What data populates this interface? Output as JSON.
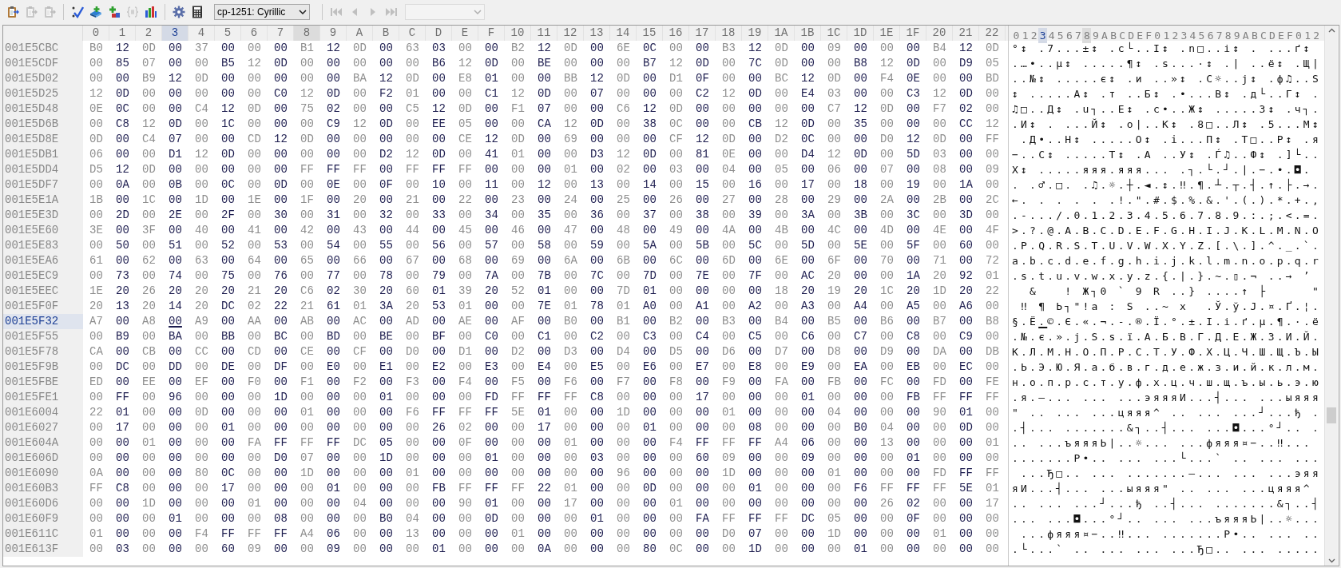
{
  "toolbar": [
    {
      "kind": "clipboard",
      "disabled": false
    },
    {
      "kind": "clipboard",
      "disabled": true
    },
    {
      "kind": "clipboard",
      "disabled": true
    },
    {
      "kind": "separator"
    },
    {
      "kind": "check",
      "disabled": false
    },
    {
      "kind": "book-plus",
      "disabled": false
    },
    {
      "kind": "blocks-plus",
      "disabled": false
    },
    {
      "kind": "brackets",
      "disabled": true
    },
    {
      "kind": "bar-chart",
      "disabled": false
    },
    {
      "kind": "separator"
    },
    {
      "kind": "gear",
      "disabled": false
    },
    {
      "kind": "calculator",
      "disabled": false
    },
    {
      "kind": "dropdown",
      "value": "cp-1251: Cyrillic",
      "disabled": false
    },
    {
      "kind": "separator"
    },
    {
      "kind": "first",
      "disabled": true
    },
    {
      "kind": "prev",
      "disabled": true
    },
    {
      "kind": "next",
      "disabled": true
    },
    {
      "kind": "last",
      "disabled": true
    },
    {
      "kind": "dropdown",
      "disabled": true
    }
  ],
  "columns": [
    {
      "label": "0",
      "selected": false,
      "marked": false
    },
    {
      "label": "1",
      "selected": false,
      "marked": false
    },
    {
      "label": "2",
      "selected": false,
      "marked": false
    },
    {
      "label": "3",
      "selected": true,
      "marked": false
    },
    {
      "label": "4",
      "selected": false,
      "marked": false
    },
    {
      "label": "5",
      "selected": false,
      "marked": false
    },
    {
      "label": "6",
      "selected": false,
      "marked": false
    },
    {
      "label": "7",
      "selected": false,
      "marked": false
    },
    {
      "label": "8",
      "selected": false,
      "marked": true
    },
    {
      "label": "9",
      "selected": false,
      "marked": false
    },
    {
      "label": "A",
      "selected": false,
      "marked": false
    },
    {
      "label": "B",
      "selected": false,
      "marked": false
    },
    {
      "label": "C",
      "selected": false,
      "marked": false
    },
    {
      "label": "D",
      "selected": false,
      "marked": false
    },
    {
      "label": "E",
      "selected": false,
      "marked": false
    },
    {
      "label": "F",
      "selected": false,
      "marked": false
    },
    {
      "label": "10",
      "selected": false,
      "marked": false
    },
    {
      "label": "11",
      "selected": false,
      "marked": false
    },
    {
      "label": "12",
      "selected": false,
      "marked": false
    },
    {
      "label": "13",
      "selected": false,
      "marked": false
    },
    {
      "label": "14",
      "selected": false,
      "marked": false
    },
    {
      "label": "15",
      "selected": false,
      "marked": false
    },
    {
      "label": "16",
      "selected": false,
      "marked": false
    },
    {
      "label": "17",
      "selected": false,
      "marked": false
    },
    {
      "label": "18",
      "selected": false,
      "marked": false
    },
    {
      "label": "19",
      "selected": false,
      "marked": false
    },
    {
      "label": "1A",
      "selected": false,
      "marked": false
    },
    {
      "label": "1B",
      "selected": false,
      "marked": false
    },
    {
      "label": "1C",
      "selected": false,
      "marked": false
    },
    {
      "label": "1D",
      "selected": false,
      "marked": false
    },
    {
      "label": "1E",
      "selected": false,
      "marked": false
    },
    {
      "label": "1F",
      "selected": false,
      "marked": false
    },
    {
      "label": "20",
      "selected": false,
      "marked": false
    },
    {
      "label": "21",
      "selected": false,
      "marked": false
    },
    {
      "label": "22",
      "selected": false,
      "marked": false
    }
  ],
  "text_header": "0123456789ABCDEF0123456789ABCDEF012",
  "rows": [
    {
      "offset": "001E5CBC",
      "selected": false,
      "bytes": [
        "B0",
        "12",
        "0D",
        "00",
        "37",
        "00",
        "00",
        "00",
        "B1",
        "12",
        "0D",
        "00",
        "63",
        "03",
        "00",
        "00",
        "B2",
        "12",
        "0D",
        "00",
        "6E",
        "0C",
        "00",
        "00",
        "B3",
        "12",
        "0D",
        "00",
        "09",
        "00",
        "00",
        "00",
        "B4",
        "12",
        "0D"
      ],
      "text": "°↕ .7...±↕ .c└..І↕ .n□..і↕ . ...ґ↕ "
    },
    {
      "offset": "001E5CDF",
      "selected": false,
      "bytes": [
        "00",
        "85",
        "07",
        "00",
        "00",
        "B5",
        "12",
        "0D",
        "00",
        "00",
        "00",
        "00",
        "00",
        "B6",
        "12",
        "0D",
        "00",
        "BE",
        "00",
        "00",
        "00",
        "B7",
        "12",
        "0D",
        "00",
        "7C",
        "0D",
        "00",
        "00",
        "B8",
        "12",
        "0D",
        "00",
        "D9",
        "05"
      ],
      "text": ".…•..µ↕ .....¶↕ .ѕ...·↕ .| ..ё↕ .Щ|"
    },
    {
      "offset": "001E5D02",
      "selected": false,
      "bytes": [
        "00",
        "00",
        "B9",
        "12",
        "0D",
        "00",
        "00",
        "00",
        "00",
        "00",
        "BA",
        "12",
        "0D",
        "00",
        "E8",
        "01",
        "00",
        "00",
        "BB",
        "12",
        "0D",
        "00",
        "D1",
        "0F",
        "00",
        "00",
        "BC",
        "12",
        "0D",
        "00",
        "F4",
        "0E",
        "00",
        "00",
        "BD"
      ],
      "text": "..№↕ .....є↕ .и ..»↕ .С☼..ј↕ .ф♫..Ѕ"
    },
    {
      "offset": "001E5D25",
      "selected": false,
      "bytes": [
        "12",
        "0D",
        "00",
        "00",
        "00",
        "00",
        "00",
        "C0",
        "12",
        "0D",
        "00",
        "F2",
        "01",
        "00",
        "00",
        "C1",
        "12",
        "0D",
        "00",
        "07",
        "00",
        "00",
        "00",
        "C2",
        "12",
        "0D",
        "00",
        "E4",
        "03",
        "00",
        "00",
        "C3",
        "12",
        "0D",
        "00"
      ],
      "text": "↕ .....А↕ .т ..Б↕ .•...В↕ .д└..Г↕ ."
    },
    {
      "offset": "001E5D48",
      "selected": false,
      "bytes": [
        "0E",
        "0C",
        "00",
        "00",
        "C4",
        "12",
        "0D",
        "00",
        "75",
        "02",
        "00",
        "00",
        "C5",
        "12",
        "0D",
        "00",
        "F1",
        "07",
        "00",
        "00",
        "C6",
        "12",
        "0D",
        "00",
        "00",
        "00",
        "00",
        "00",
        "C7",
        "12",
        "0D",
        "00",
        "F7",
        "02",
        "00"
      ],
      "text": "♫□..Д↕ .u┐..Е↕ .с•..Ж↕ .....З↕ .ч┐."
    },
    {
      "offset": "001E5D6B",
      "selected": false,
      "bytes": [
        "00",
        "C8",
        "12",
        "0D",
        "00",
        "1C",
        "00",
        "00",
        "00",
        "C9",
        "12",
        "0D",
        "00",
        "EE",
        "05",
        "00",
        "00",
        "CA",
        "12",
        "0D",
        "00",
        "38",
        "0C",
        "00",
        "00",
        "CB",
        "12",
        "0D",
        "00",
        "35",
        "00",
        "00",
        "00",
        "CC",
        "12"
      ],
      "text": ".И↕ . ...Й↕ .о|..К↕ .8□..Л↕ .5...М↕"
    },
    {
      "offset": "001E5D8E",
      "selected": false,
      "bytes": [
        "0D",
        "00",
        "C4",
        "07",
        "00",
        "00",
        "CD",
        "12",
        "0D",
        "00",
        "00",
        "00",
        "00",
        "00",
        "CE",
        "12",
        "0D",
        "00",
        "69",
        "00",
        "00",
        "00",
        "CF",
        "12",
        "0D",
        "00",
        "D2",
        "0C",
        "00",
        "00",
        "D0",
        "12",
        "0D",
        "00",
        "FF"
      ],
      "text": " .Д•..Н↕ .....О↕ .i...П↕ .Т□..Р↕ .я"
    },
    {
      "offset": "001E5DB1",
      "selected": false,
      "bytes": [
        "06",
        "00",
        "00",
        "D1",
        "12",
        "0D",
        "00",
        "00",
        "00",
        "00",
        "00",
        "D2",
        "12",
        "0D",
        "00",
        "41",
        "01",
        "00",
        "00",
        "D3",
        "12",
        "0D",
        "00",
        "81",
        "0E",
        "00",
        "00",
        "D4",
        "12",
        "0D",
        "00",
        "5D",
        "03",
        "00",
        "00"
      ],
      "text": "−..С↕ .....Т↕ .A ..У↕ .Ѓ♫..Ф↕ .]└.."
    },
    {
      "offset": "001E5DD4",
      "selected": false,
      "bytes": [
        "D5",
        "12",
        "0D",
        "00",
        "00",
        "00",
        "00",
        "00",
        "FF",
        "FF",
        "FF",
        "00",
        "FF",
        "FF",
        "FF",
        "00",
        "00",
        "00",
        "01",
        "00",
        "02",
        "00",
        "03",
        "00",
        "04",
        "00",
        "05",
        "00",
        "06",
        "00",
        "07",
        "00",
        "08",
        "00",
        "09"
      ],
      "text": "Х↕ .....яяя.яяя... .┐.└.┘.|.−.•.◘. "
    },
    {
      "offset": "001E5DF7",
      "selected": false,
      "bytes": [
        "00",
        "0A",
        "00",
        "0B",
        "00",
        "0C",
        "00",
        "0D",
        "00",
        "0E",
        "00",
        "0F",
        "00",
        "10",
        "00",
        "11",
        "00",
        "12",
        "00",
        "13",
        "00",
        "14",
        "00",
        "15",
        "00",
        "16",
        "00",
        "17",
        "00",
        "18",
        "00",
        "19",
        "00",
        "1A",
        "00"
      ],
      "text": ". .♂.□. .♫.☼.┼.◄.↕.‼.¶.┴.┬.┤.↑.├.→."
    },
    {
      "offset": "001E5E1A",
      "selected": false,
      "bytes": [
        "1B",
        "00",
        "1C",
        "00",
        "1D",
        "00",
        "1E",
        "00",
        "1F",
        "00",
        "20",
        "00",
        "21",
        "00",
        "22",
        "00",
        "23",
        "00",
        "24",
        "00",
        "25",
        "00",
        "26",
        "00",
        "27",
        "00",
        "28",
        "00",
        "29",
        "00",
        "2A",
        "00",
        "2B",
        "00",
        "2C"
      ],
      "text": "←. . . . . .!.\".#.$.%.&.'.(.).*.+.,"
    },
    {
      "offset": "001E5E3D",
      "selected": false,
      "bytes": [
        "00",
        "2D",
        "00",
        "2E",
        "00",
        "2F",
        "00",
        "30",
        "00",
        "31",
        "00",
        "32",
        "00",
        "33",
        "00",
        "34",
        "00",
        "35",
        "00",
        "36",
        "00",
        "37",
        "00",
        "38",
        "00",
        "39",
        "00",
        "3A",
        "00",
        "3B",
        "00",
        "3C",
        "00",
        "3D",
        "00"
      ],
      "text": ".-.../.0.1.2.3.4.5.6.7.8.9.:.;.<.=."
    },
    {
      "offset": "001E5E60",
      "selected": false,
      "bytes": [
        "3E",
        "00",
        "3F",
        "00",
        "40",
        "00",
        "41",
        "00",
        "42",
        "00",
        "43",
        "00",
        "44",
        "00",
        "45",
        "00",
        "46",
        "00",
        "47",
        "00",
        "48",
        "00",
        "49",
        "00",
        "4A",
        "00",
        "4B",
        "00",
        "4C",
        "00",
        "4D",
        "00",
        "4E",
        "00",
        "4F"
      ],
      "text": ">.?.@.A.B.C.D.E.F.G.H.I.J.K.L.M.N.O"
    },
    {
      "offset": "001E5E83",
      "selected": false,
      "bytes": [
        "00",
        "50",
        "00",
        "51",
        "00",
        "52",
        "00",
        "53",
        "00",
        "54",
        "00",
        "55",
        "00",
        "56",
        "00",
        "57",
        "00",
        "58",
        "00",
        "59",
        "00",
        "5A",
        "00",
        "5B",
        "00",
        "5C",
        "00",
        "5D",
        "00",
        "5E",
        "00",
        "5F",
        "00",
        "60",
        "00"
      ],
      "text": ".P.Q.R.S.T.U.V.W.X.Y.Z.[.\\.].^._.`."
    },
    {
      "offset": "001E5EA6",
      "selected": false,
      "bytes": [
        "61",
        "00",
        "62",
        "00",
        "63",
        "00",
        "64",
        "00",
        "65",
        "00",
        "66",
        "00",
        "67",
        "00",
        "68",
        "00",
        "69",
        "00",
        "6A",
        "00",
        "6B",
        "00",
        "6C",
        "00",
        "6D",
        "00",
        "6E",
        "00",
        "6F",
        "00",
        "70",
        "00",
        "71",
        "00",
        "72"
      ],
      "text": "a.b.c.d.e.f.g.h.i.j.k.l.m.n.o.p.q.r"
    },
    {
      "offset": "001E5EC9",
      "selected": false,
      "bytes": [
        "00",
        "73",
        "00",
        "74",
        "00",
        "75",
        "00",
        "76",
        "00",
        "77",
        "00",
        "78",
        "00",
        "79",
        "00",
        "7A",
        "00",
        "7B",
        "00",
        "7C",
        "00",
        "7D",
        "00",
        "7E",
        "00",
        "7F",
        "00",
        "AC",
        "20",
        "00",
        "00",
        "1A",
        "20",
        "92",
        "01"
      ],
      "text": ".s.t.u.v.w.x.y.z.{.|.}.~.▯.¬ ..→ ’ "
    },
    {
      "offset": "001E5EEC",
      "selected": false,
      "bytes": [
        "1E",
        "20",
        "26",
        "20",
        "20",
        "20",
        "21",
        "20",
        "C6",
        "02",
        "30",
        "20",
        "60",
        "01",
        "39",
        "20",
        "52",
        "01",
        "00",
        "00",
        "7D",
        "01",
        "00",
        "00",
        "00",
        "00",
        "18",
        "20",
        "19",
        "20",
        "1C",
        "20",
        "1D",
        "20",
        "22"
      ],
      "text": "  &   ! Ж┐0 ` 9 R ..} ....↑ ├     \""
    },
    {
      "offset": "001E5F0F",
      "selected": false,
      "bytes": [
        "20",
        "13",
        "20",
        "14",
        "20",
        "DC",
        "02",
        "22",
        "21",
        "61",
        "01",
        "3A",
        "20",
        "53",
        "01",
        "00",
        "00",
        "7E",
        "01",
        "78",
        "01",
        "A0",
        "00",
        "A1",
        "00",
        "A2",
        "00",
        "A3",
        "00",
        "A4",
        "00",
        "A5",
        "00",
        "A6",
        "00"
      ],
      "text": " ‼ ¶ Ь┐\"!a : S ..~ x  .Ў.ў.Ј.¤.Ґ.¦."
    },
    {
      "offset": "001E5F32",
      "selected": true,
      "bytes": [
        "A7",
        "00",
        "A8",
        "00",
        "A9",
        "00",
        "AA",
        "00",
        "AB",
        "00",
        "AC",
        "00",
        "AD",
        "00",
        "AE",
        "00",
        "AF",
        "00",
        "B0",
        "00",
        "B1",
        "00",
        "B2",
        "00",
        "B3",
        "00",
        "B4",
        "00",
        "B5",
        "00",
        "B6",
        "00",
        "B7",
        "00",
        "B8"
      ],
      "text": "§.Ё.©.Є.«.¬.-.®.Ї.°.±.І.і.ґ.µ.¶.·.ё"
    },
    {
      "offset": "001E5F55",
      "selected": false,
      "bytes": [
        "00",
        "B9",
        "00",
        "BA",
        "00",
        "BB",
        "00",
        "BC",
        "00",
        "BD",
        "00",
        "BE",
        "00",
        "BF",
        "00",
        "C0",
        "00",
        "C1",
        "00",
        "C2",
        "00",
        "C3",
        "00",
        "C4",
        "00",
        "C5",
        "00",
        "C6",
        "00",
        "C7",
        "00",
        "C8",
        "00",
        "C9",
        "00"
      ],
      "text": ".№.є.».ј.Ѕ.ѕ.ї.А.Б.В.Г.Д.Е.Ж.З.И.Й."
    },
    {
      "offset": "001E5F78",
      "selected": false,
      "bytes": [
        "CA",
        "00",
        "CB",
        "00",
        "CC",
        "00",
        "CD",
        "00",
        "CE",
        "00",
        "CF",
        "00",
        "D0",
        "00",
        "D1",
        "00",
        "D2",
        "00",
        "D3",
        "00",
        "D4",
        "00",
        "D5",
        "00",
        "D6",
        "00",
        "D7",
        "00",
        "D8",
        "00",
        "D9",
        "00",
        "DA",
        "00",
        "DB"
      ],
      "text": "К.Л.М.Н.О.П.Р.С.Т.У.Ф.Х.Ц.Ч.Ш.Щ.Ъ.Ы"
    },
    {
      "offset": "001E5F9B",
      "selected": false,
      "bytes": [
        "00",
        "DC",
        "00",
        "DD",
        "00",
        "DE",
        "00",
        "DF",
        "00",
        "E0",
        "00",
        "E1",
        "00",
        "E2",
        "00",
        "E3",
        "00",
        "E4",
        "00",
        "E5",
        "00",
        "E6",
        "00",
        "E7",
        "00",
        "E8",
        "00",
        "E9",
        "00",
        "EA",
        "00",
        "EB",
        "00",
        "EC",
        "00"
      ],
      "text": ".Ь.Э.Ю.Я.а.б.в.г.д.е.ж.з.и.й.к.л.м."
    },
    {
      "offset": "001E5FBE",
      "selected": false,
      "bytes": [
        "ED",
        "00",
        "EE",
        "00",
        "EF",
        "00",
        "F0",
        "00",
        "F1",
        "00",
        "F2",
        "00",
        "F3",
        "00",
        "F4",
        "00",
        "F5",
        "00",
        "F6",
        "00",
        "F7",
        "00",
        "F8",
        "00",
        "F9",
        "00",
        "FA",
        "00",
        "FB",
        "00",
        "FC",
        "00",
        "FD",
        "00",
        "FE"
      ],
      "text": "н.о.п.р.с.т.у.ф.х.ц.ч.ш.щ.ъ.ы.ь.э.ю"
    },
    {
      "offset": "001E5FE1",
      "selected": false,
      "bytes": [
        "00",
        "FF",
        "00",
        "96",
        "00",
        "00",
        "00",
        "1D",
        "00",
        "00",
        "00",
        "01",
        "00",
        "00",
        "00",
        "FD",
        "FF",
        "FF",
        "FF",
        "C8",
        "00",
        "00",
        "00",
        "17",
        "00",
        "00",
        "00",
        "01",
        "00",
        "00",
        "00",
        "FB",
        "FF",
        "FF",
        "FF"
      ],
      "text": ".я.–... ... ...эяяяИ...┤... ...ыяяя"
    },
    {
      "offset": "001E6004",
      "selected": false,
      "bytes": [
        "22",
        "01",
        "00",
        "00",
        "0D",
        "00",
        "00",
        "00",
        "01",
        "00",
        "00",
        "00",
        "F6",
        "FF",
        "FF",
        "FF",
        "5E",
        "01",
        "00",
        "00",
        "1D",
        "00",
        "00",
        "00",
        "01",
        "00",
        "00",
        "00",
        "04",
        "00",
        "00",
        "00",
        "90",
        "01",
        "00"
      ],
      "text": "\" .. ... ...цяяя^ .. ... ...┘...ђ ."
    },
    {
      "offset": "001E6027",
      "selected": false,
      "bytes": [
        "00",
        "17",
        "00",
        "00",
        "00",
        "01",
        "00",
        "00",
        "00",
        "00",
        "00",
        "00",
        "00",
        "26",
        "02",
        "00",
        "00",
        "17",
        "00",
        "00",
        "00",
        "01",
        "00",
        "00",
        "00",
        "08",
        "00",
        "00",
        "00",
        "B0",
        "04",
        "00",
        "00",
        "0D",
        "00"
      ],
      "text": ".┤... .......&┐..┤... ...◘...°┘.. ."
    },
    {
      "offset": "001E604A",
      "selected": false,
      "bytes": [
        "00",
        "00",
        "01",
        "00",
        "00",
        "00",
        "FA",
        "FF",
        "FF",
        "FF",
        "DC",
        "05",
        "00",
        "00",
        "0F",
        "00",
        "00",
        "00",
        "01",
        "00",
        "00",
        "00",
        "F4",
        "FF",
        "FF",
        "FF",
        "A4",
        "06",
        "00",
        "00",
        "13",
        "00",
        "00",
        "00",
        "01"
      ],
      "text": ".. ...ъяяяЬ|..☼... ...фяяя¤−..‼... "
    },
    {
      "offset": "001E606D",
      "selected": false,
      "bytes": [
        "00",
        "00",
        "00",
        "00",
        "00",
        "00",
        "00",
        "D0",
        "07",
        "00",
        "00",
        "1D",
        "00",
        "00",
        "00",
        "01",
        "00",
        "00",
        "00",
        "03",
        "00",
        "00",
        "00",
        "60",
        "09",
        "00",
        "00",
        "09",
        "00",
        "00",
        "00",
        "01",
        "00",
        "00",
        "00"
      ],
      "text": ".......Р•.. ... ...└...` .. ... ..."
    },
    {
      "offset": "001E6090",
      "selected": false,
      "bytes": [
        "0A",
        "00",
        "00",
        "00",
        "80",
        "0C",
        "00",
        "00",
        "1D",
        "00",
        "00",
        "00",
        "01",
        "00",
        "00",
        "00",
        "00",
        "00",
        "00",
        "00",
        "96",
        "00",
        "00",
        "00",
        "1D",
        "00",
        "00",
        "00",
        "01",
        "00",
        "00",
        "00",
        "FD",
        "FF",
        "FF"
      ],
      "text": " ...Ђ□.. ... .......–... ... ...эяя"
    },
    {
      "offset": "001E60B3",
      "selected": false,
      "bytes": [
        "FF",
        "C8",
        "00",
        "00",
        "00",
        "17",
        "00",
        "00",
        "00",
        "01",
        "00",
        "00",
        "00",
        "FB",
        "FF",
        "FF",
        "FF",
        "22",
        "01",
        "00",
        "00",
        "0D",
        "00",
        "00",
        "00",
        "01",
        "00",
        "00",
        "00",
        "F6",
        "FF",
        "FF",
        "FF",
        "5E",
        "01"
      ],
      "text": "яИ...┤... ...ыяяя\" .. ... ...цяяя^ "
    },
    {
      "offset": "001E60D6",
      "selected": false,
      "bytes": [
        "00",
        "00",
        "1D",
        "00",
        "00",
        "00",
        "01",
        "00",
        "00",
        "00",
        "04",
        "00",
        "00",
        "00",
        "90",
        "01",
        "00",
        "00",
        "17",
        "00",
        "00",
        "00",
        "01",
        "00",
        "00",
        "00",
        "00",
        "00",
        "00",
        "00",
        "26",
        "02",
        "00",
        "00",
        "17"
      ],
      "text": ".. ... ...┘...ђ ..┤... .......&┐..┤"
    },
    {
      "offset": "001E60F9",
      "selected": false,
      "bytes": [
        "00",
        "00",
        "00",
        "01",
        "00",
        "00",
        "00",
        "08",
        "00",
        "00",
        "00",
        "B0",
        "04",
        "00",
        "00",
        "0D",
        "00",
        "00",
        "00",
        "01",
        "00",
        "00",
        "00",
        "FA",
        "FF",
        "FF",
        "FF",
        "DC",
        "05",
        "00",
        "00",
        "0F",
        "00",
        "00",
        "00"
      ],
      "text": "... ...◘...°┘.. ... ...ъяяяЬ|..☼..."
    },
    {
      "offset": "001E611C",
      "selected": false,
      "bytes": [
        "01",
        "00",
        "00",
        "00",
        "F4",
        "FF",
        "FF",
        "FF",
        "A4",
        "06",
        "00",
        "00",
        "13",
        "00",
        "00",
        "00",
        "01",
        "00",
        "00",
        "00",
        "00",
        "00",
        "00",
        "00",
        "D0",
        "07",
        "00",
        "00",
        "1D",
        "00",
        "00",
        "00",
        "01",
        "00",
        "00"
      ],
      "text": " ...фяяя¤−..‼... .......Р•.. ... .."
    },
    {
      "offset": "001E613F",
      "selected": false,
      "bytes": [
        "00",
        "03",
        "00",
        "00",
        "00",
        "60",
        "09",
        "00",
        "00",
        "09",
        "00",
        "00",
        "00",
        "01",
        "00",
        "00",
        "00",
        "0A",
        "00",
        "00",
        "00",
        "80",
        "0C",
        "00",
        "00",
        "1D",
        "00",
        "00",
        "00",
        "01",
        "00",
        "00",
        "00",
        "00",
        "00"
      ],
      "text": ".└...` .. ... ... ...Ђ□.. ... ....."
    }
  ]
}
